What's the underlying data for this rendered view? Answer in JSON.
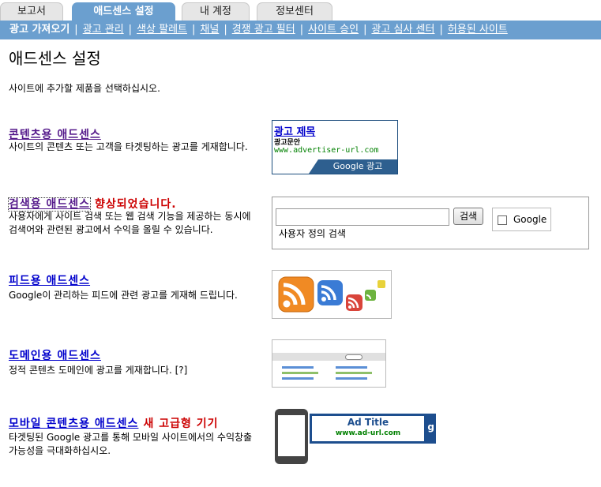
{
  "tabs": [
    "보고서",
    "애드센스 설정",
    "내 계정",
    "정보센터"
  ],
  "subnav": [
    "광고 가져오기",
    "광고 관리",
    "색상 팔레트",
    "채널",
    "경쟁 광고 필터",
    "사이트 승인",
    "광고 심사 센터",
    "허용된 사이트"
  ],
  "page_title": "애드센스 설정",
  "intro": "사이트에 추가할 제품을 선택하십시오.",
  "products": [
    {
      "title": "콘텐츠용 애드센스",
      "desc": "사이트의 콘텐츠 또는 고객을 타겟팅하는 광고를 게재합니다.",
      "badge": ""
    },
    {
      "title": "검색용 애드센스",
      "desc": "사용자에게 사이트 검색 또는 웹 검색 기능을 제공하는 동시에 검색어와 관련된 광고에서 수익을 올릴 수 있습니다.",
      "badge": "향상되었습니다."
    },
    {
      "title": "피드용 애드센스",
      "desc": "Google이 관리하는 피드에 관련 광고를 게재해 드립니다.",
      "badge": ""
    },
    {
      "title": "도메인용 애드센스",
      "desc": "정적 콘텐츠 도메인에 광고를 게재합니다. [?]",
      "badge": ""
    },
    {
      "title": "모바일 콘텐츠용 애드센스",
      "desc": "타겟팅된 Google 광고를 통해 모바일 사이트에서의 수익창출 가능성을 극대화하십시오.",
      "badge": "새 고급형 기기"
    }
  ],
  "ad_sample": {
    "title": "광고 제목",
    "body": "광고문안",
    "url": "www.advertiser-url.com",
    "footer": "Google 광고"
  },
  "search_sample": {
    "button": "검색",
    "caption": "사용자 정의 검색",
    "google": "Google"
  },
  "mobile_sample": {
    "title": "Ad Title",
    "url": "www.ad-url.com",
    "g": "g"
  },
  "colors": {
    "nav_blue": "#6b9fcf",
    "link": "#0000cc",
    "badge_red": "#cc0000"
  }
}
